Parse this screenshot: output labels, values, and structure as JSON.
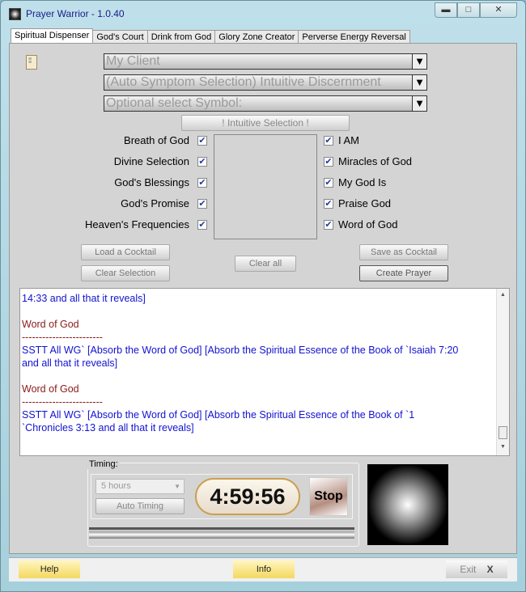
{
  "window": {
    "title": "Prayer Warrior - 1.0.40"
  },
  "tabs": [
    "Spiritual Dispenser",
    "God's Court",
    "Drink from God",
    "Glory Zone Creator",
    "Perverse Energy Reversal"
  ],
  "combos": {
    "client": "My Client",
    "symptom": "(Auto Symptom Selection) Intuitive Discernment",
    "symbol": "Optional select Symbol:"
  },
  "intuitive_button": "! Intuitive Selection !",
  "left_checks": [
    {
      "label": "Breath of God",
      "checked": true
    },
    {
      "label": "Divine Selection",
      "checked": true
    },
    {
      "label": "God's Blessings",
      "checked": true
    },
    {
      "label": "God's Promise",
      "checked": true
    },
    {
      "label": "Heaven's Frequencies",
      "checked": true
    }
  ],
  "right_checks": [
    {
      "label": "I AM",
      "checked": true
    },
    {
      "label": "Miracles of God",
      "checked": true
    },
    {
      "label": "My God Is",
      "checked": true
    },
    {
      "label": "Praise God",
      "checked": true
    },
    {
      "label": "Word of God",
      "checked": true
    }
  ],
  "buttons": {
    "load": "Load a Cocktail",
    "clear_selection": "Clear Selection",
    "clear_all": "Clear all",
    "save": "Save as Cocktail",
    "create": "Create Prayer"
  },
  "output": [
    {
      "t": "14:33 and all that it reveals]",
      "c": "b"
    },
    {
      "t": "",
      "c": "b"
    },
    {
      "t": "Word of God",
      "c": "r"
    },
    {
      "t": "------------------------",
      "c": "r"
    },
    {
      "t": "SSTT All WG` [Absorb the Word of God] [Absorb the Spiritual Essence of the Book of `Isaiah 7:20",
      "c": "b"
    },
    {
      "t": "and all that it reveals]",
      "c": "b"
    },
    {
      "t": "",
      "c": "b"
    },
    {
      "t": "Word of God",
      "c": "r"
    },
    {
      "t": "------------------------",
      "c": "r"
    },
    {
      "t": "SSTT All WG` [Absorb the Word of God] [Absorb the Spiritual Essence of the Book of `1",
      "c": "b"
    },
    {
      "t": "`Chronicles 3:13 and all that it reveals]",
      "c": "b"
    }
  ],
  "timing": {
    "label": "Timing:",
    "duration": "5 hours",
    "auto": "Auto Timing",
    "clock": "4:59:56",
    "stop": "Stop"
  },
  "footer": {
    "help": "Help",
    "info": "Info",
    "exit": "Exit"
  }
}
